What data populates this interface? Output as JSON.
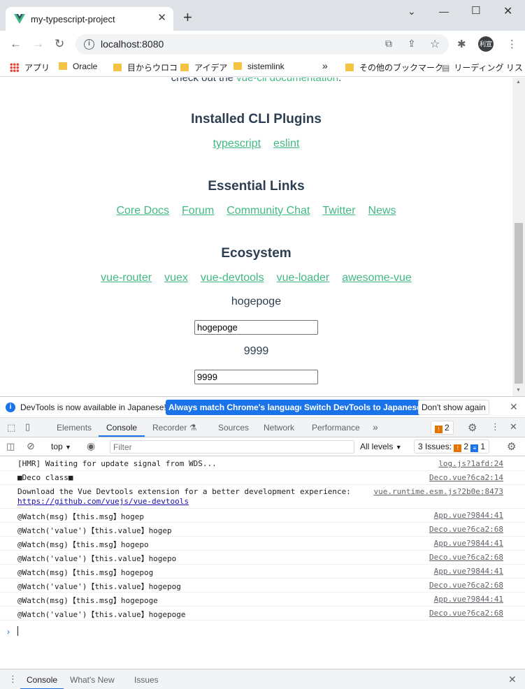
{
  "browser": {
    "tab_title": "my-typescript-project",
    "url": "localhost:8080",
    "avatar_text": "利宣",
    "bookmarks": [
      "アプリ",
      "Oracle",
      "目からウロコ",
      "アイデア",
      "sistemlink",
      "その他のブックマーク",
      "リーディング リスト"
    ],
    "more_bookmarks": "»"
  },
  "page": {
    "cut_text": "check out the",
    "cut_link": "vue-cli documentation",
    "installed_title": "Installed CLI Plugins",
    "installed_links": [
      "typescript",
      "eslint"
    ],
    "essential_title": "Essential Links",
    "essential_links": [
      "Core Docs",
      "Forum",
      "Community Chat",
      "Twitter",
      "News"
    ],
    "ecosystem_title": "Ecosystem",
    "ecosystem_links": [
      "vue-router",
      "vuex",
      "vue-devtools",
      "vue-loader",
      "awesome-vue"
    ],
    "msg_text": "hogepoge",
    "msg_input": "hogepoge",
    "num_text": "9999",
    "num_input": "9999"
  },
  "devtools": {
    "infobar_text": "DevTools is now available in Japanese!",
    "btn_match": "Always match Chrome's language",
    "btn_switch": "Switch DevTools to Japanese",
    "btn_dont_show": "Don't show again",
    "tabs": [
      "Elements",
      "Console",
      "Recorder",
      "Sources",
      "Network",
      "Performance"
    ],
    "tabs_more": "»",
    "issue_count": "2",
    "context": "top",
    "filter_placeholder": "Filter",
    "levels": "All levels",
    "issues_label": "3 Issues:",
    "issues_warn": "2",
    "issues_info": "1",
    "console_lines": [
      {
        "msg": "[HMR] Waiting for update signal from WDS...",
        "src": "log.js?1afd:24"
      },
      {
        "msg": "■Deco class■",
        "src": "Deco.vue?6ca2:14"
      },
      {
        "msg": "Download the Vue Devtools extension for a better development experience:",
        "src": "vue.runtime.esm.js?2b0e:8473",
        "url": "https://github.com/vuejs/vue-devtools"
      },
      {
        "msg": "@Watch(msg)【this.msg】hogep",
        "src": "App.vue?9844:41"
      },
      {
        "msg": "@Watch('value')【this.value】hogep",
        "src": "Deco.vue?6ca2:68"
      },
      {
        "msg": "@Watch(msg)【this.msg】hogepo",
        "src": "App.vue?9844:41"
      },
      {
        "msg": "@Watch('value')【this.value】hogepo",
        "src": "Deco.vue?6ca2:68"
      },
      {
        "msg": "@Watch(msg)【this.msg】hogepog",
        "src": "App.vue?9844:41"
      },
      {
        "msg": "@Watch('value')【this.value】hogepog",
        "src": "Deco.vue?6ca2:68"
      },
      {
        "msg": "@Watch(msg)【this.msg】hogepoge",
        "src": "App.vue?9844:41"
      },
      {
        "msg": "@Watch('value')【this.value】hogepoge",
        "src": "Deco.vue?6ca2:68"
      }
    ],
    "drawer_tabs": [
      "Console",
      "What's New",
      "Issues"
    ]
  }
}
